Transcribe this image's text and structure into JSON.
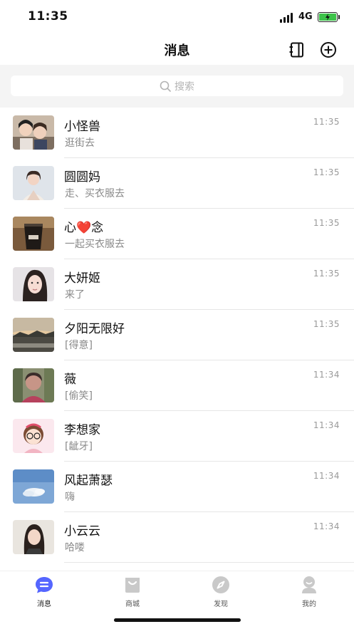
{
  "status_bar": {
    "time": "11:35",
    "network": "4G"
  },
  "header": {
    "title": "消息"
  },
  "search": {
    "placeholder": "搜索"
  },
  "conversations": [
    {
      "name": "小怪兽",
      "preview": "逛街去",
      "time": "11:35"
    },
    {
      "name": "圆圆妈",
      "preview": "走、买衣服去",
      "time": "11:35"
    },
    {
      "name": "心❤️念",
      "preview": "一起买衣服去",
      "time": "11:35"
    },
    {
      "name": "大妍姬",
      "preview": "来了",
      "time": "11:35"
    },
    {
      "name": "夕阳无限好",
      "preview": "[得意]",
      "time": "11:35"
    },
    {
      "name": "薇",
      "preview": "[偷笑]",
      "time": "11:34"
    },
    {
      "name": "李想家",
      "preview": "[龇牙]",
      "time": "11:34"
    },
    {
      "name": "风起萧瑟",
      "preview": "嗨",
      "time": "11:34"
    },
    {
      "name": "小云云",
      "preview": "哈喽",
      "time": "11:34"
    }
  ],
  "tabs": [
    {
      "label": "消息",
      "icon": "chat-bubble-icon",
      "active": true
    },
    {
      "label": "商城",
      "icon": "shopping-bag-icon",
      "active": false
    },
    {
      "label": "发现",
      "icon": "compass-icon",
      "active": false
    },
    {
      "label": "我的",
      "icon": "profile-icon",
      "active": false
    }
  ],
  "colors": {
    "search_bg": "#f4f4f4",
    "active_tab": "#5566ff",
    "inactive_tab": "#c9c9c9",
    "battery": "#3dc34a"
  }
}
